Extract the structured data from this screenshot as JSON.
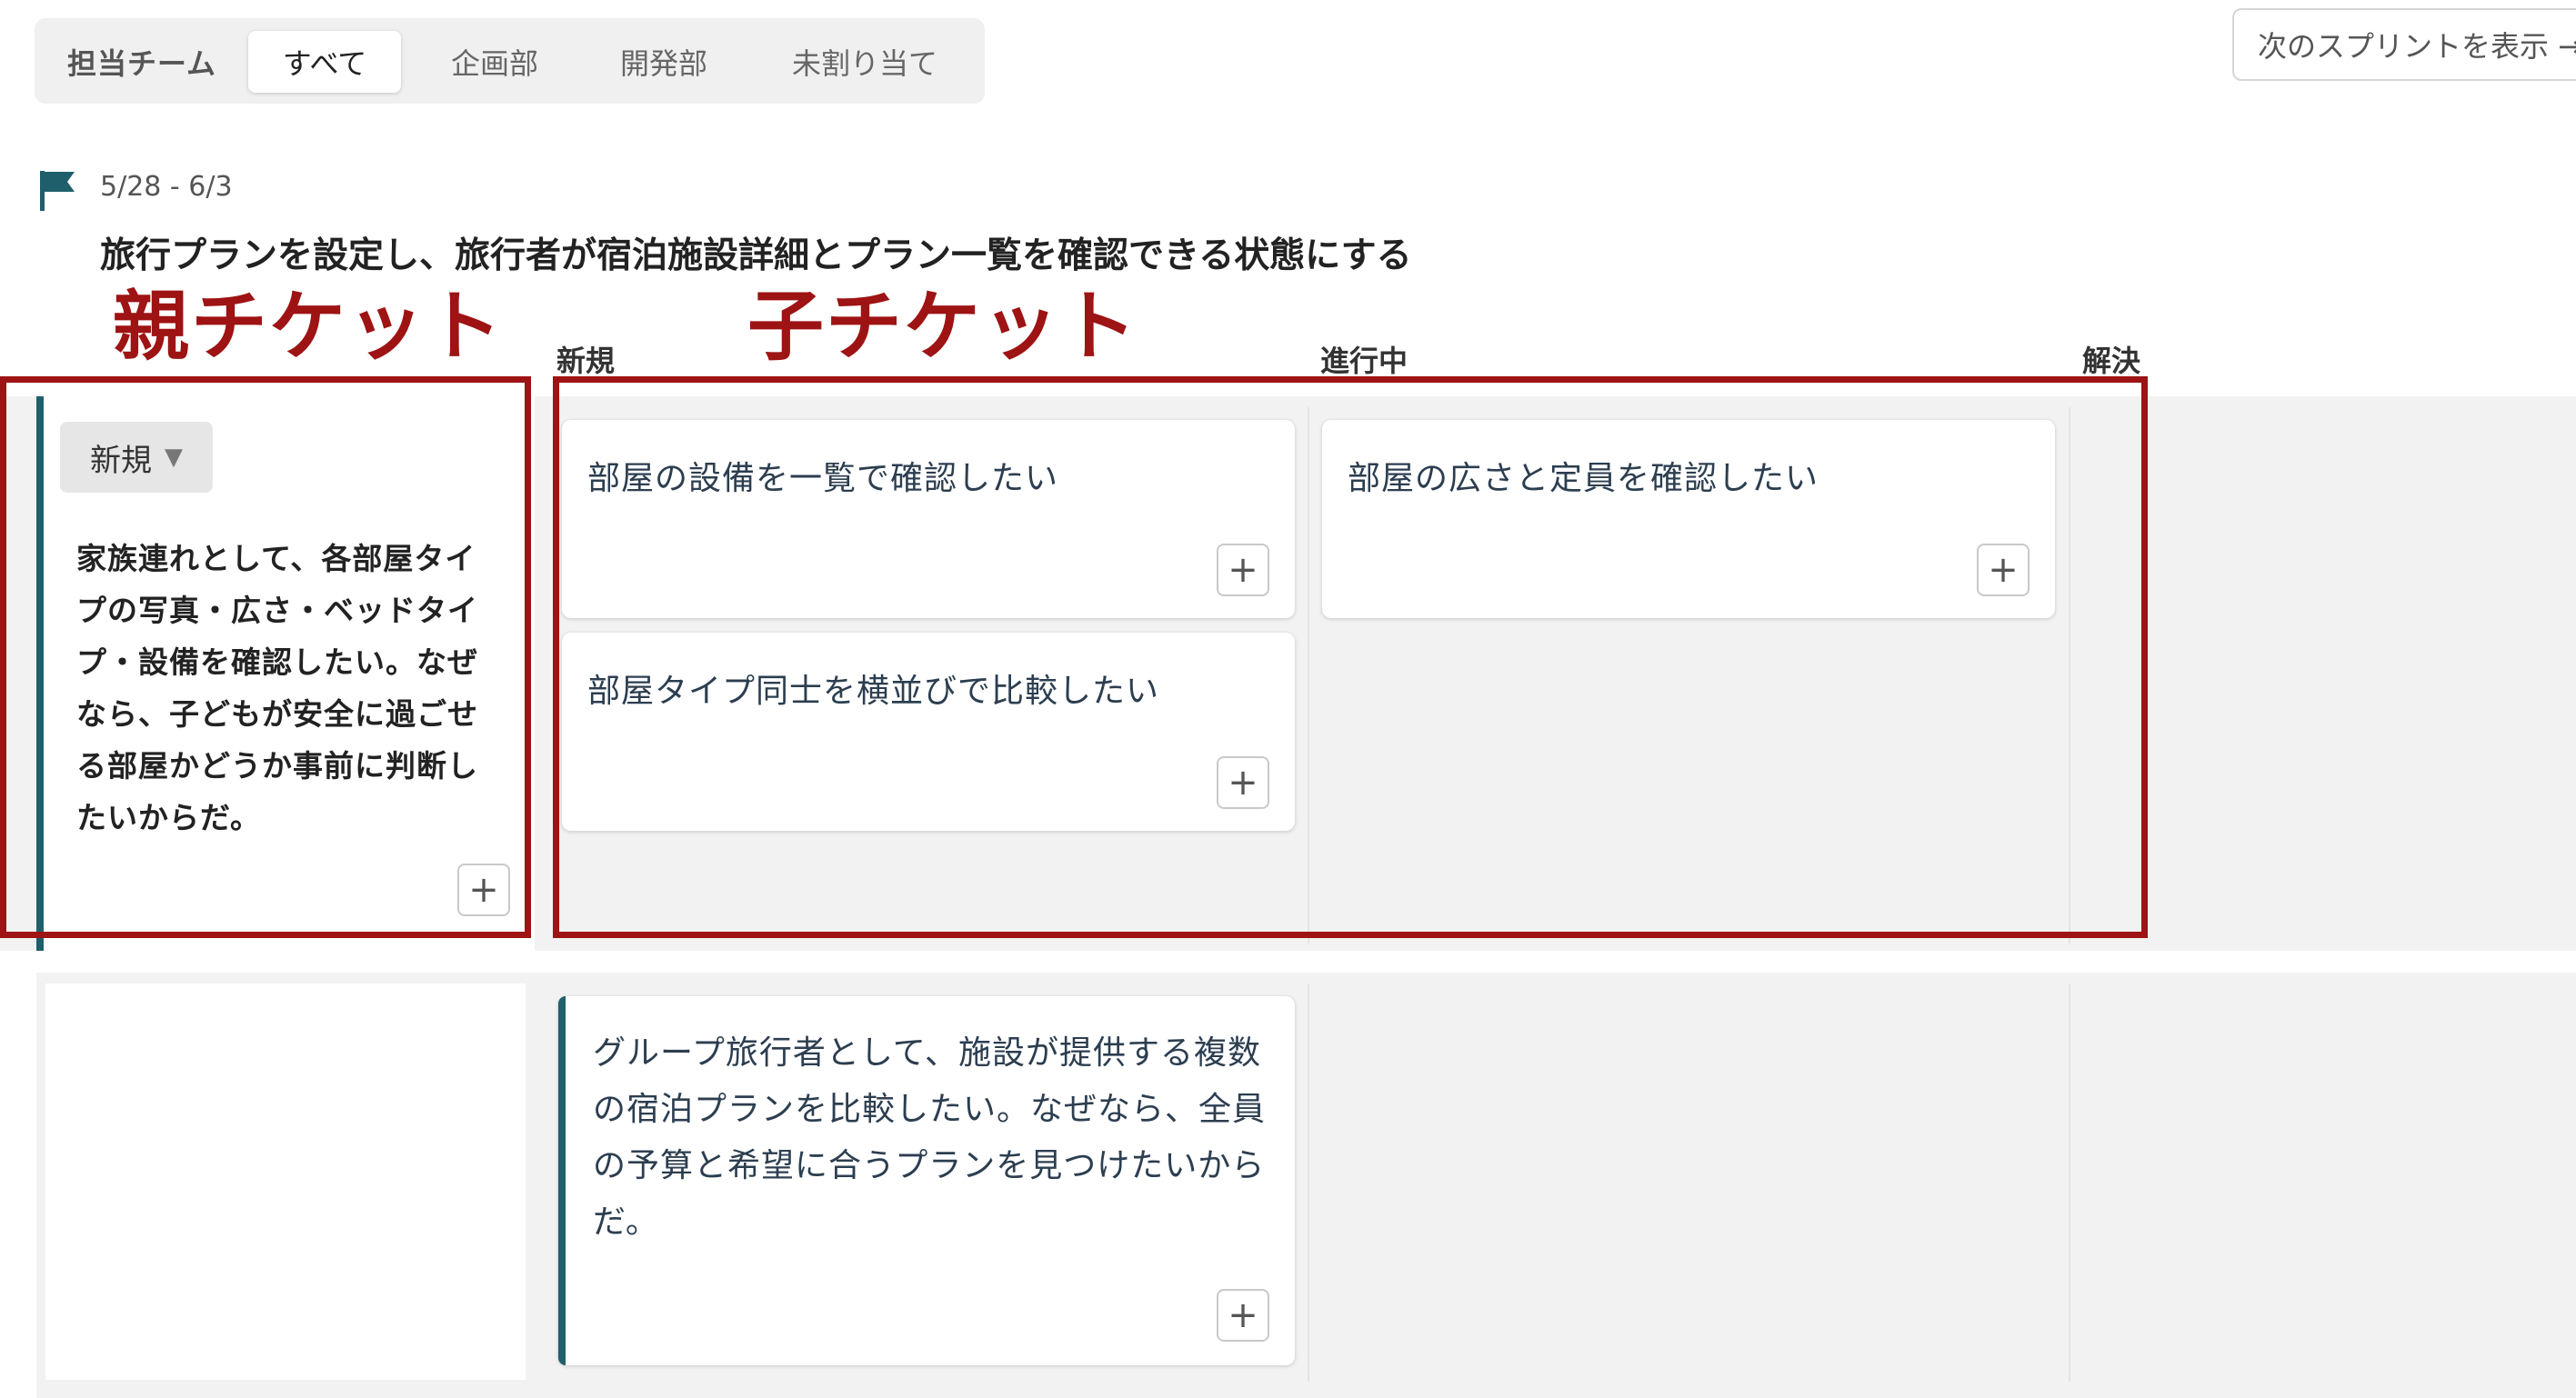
{
  "filter": {
    "label": "担当チーム",
    "tabs": [
      "すべて",
      "企画部",
      "開発部",
      "未割り当て"
    ],
    "active_index": 0
  },
  "next_sprint_button": "次のスプリントを表示 →",
  "sprint": {
    "dates": "5/28 - 6/3",
    "goal": "旅行プランを設定し、旅行者が宿泊施設詳細とプラン一覧を確認できる状態にする"
  },
  "annotations": {
    "parent": "親チケット",
    "child": "子チケット"
  },
  "columns": [
    "新規",
    "進行中",
    "解決"
  ],
  "rows": [
    {
      "parent": {
        "status": "新規",
        "text": "家族連れとして、各部屋タイプの写真・広さ・ベッドタイプ・設備を確認したい。なぜなら、子どもが安全に過ごせる部屋かどうか事前に判断したいからだ。"
      },
      "children": {
        "new": [
          "部屋の設備を一覧で確認したい",
          "部屋タイプ同士を横並びで比較したい"
        ],
        "in_progress": [
          "部屋の広さと定員を確認したい"
        ],
        "resolved": []
      }
    },
    {
      "story": "グループ旅行者として、施設が提供する複数の宿泊プランを比較したい。なぜなら、全員の予算と希望に合うプランを見つけたいからだ。"
    }
  ],
  "plus_symbol": "+",
  "dropdown_arrow": "▼",
  "colors": {
    "accent": "#1f5f6b",
    "annotation_red": "#9e1313",
    "band_bg": "#f2f2f2"
  },
  "icons": {
    "flag": "flag-icon",
    "plus": "plus-icon",
    "dropdown": "caret-down-icon"
  }
}
